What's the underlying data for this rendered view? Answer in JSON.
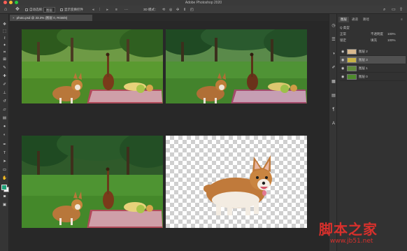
{
  "app": {
    "title": "Adobe Photoshop 2020"
  },
  "options_bar": {
    "auto_select_label": "自动选择：",
    "auto_select_value": "图层",
    "show_transform_label": "显示变换控件",
    "mode_3d_label": "3D 模式："
  },
  "document": {
    "tab_label": "photo.psd @ 33.3% (图层 0, RGB/8)"
  },
  "toolbar": {
    "tools": [
      "move",
      "marquee",
      "lasso",
      "magic-wand",
      "crop",
      "frame",
      "eyedropper",
      "healing",
      "brush",
      "stamp",
      "history-brush",
      "eraser",
      "gradient",
      "blur",
      "dodge",
      "pen",
      "type",
      "path-select",
      "rectangle",
      "hand",
      "zoom",
      "more"
    ]
  },
  "colors": {
    "foreground": "#1fa27a",
    "background": "#f2f2f2",
    "watermark": "#d8302c"
  },
  "panel": {
    "tabs": [
      "图层",
      "通道",
      "路径"
    ],
    "filter_label": "Q 类型",
    "blend_mode": "正常",
    "opacity_label": "不透明度",
    "opacity_value": "100%",
    "lock_label": "锁定",
    "fill_label": "填充",
    "fill_value": "100%",
    "layers": [
      {
        "name": "图层 2",
        "selected": false
      },
      {
        "name": "图层 3",
        "selected": true
      },
      {
        "name": "图层 1",
        "selected": false
      },
      {
        "name": "图层 0",
        "selected": false
      }
    ]
  },
  "watermark": {
    "text": "脚本之家",
    "url": "www.jb51.net"
  }
}
